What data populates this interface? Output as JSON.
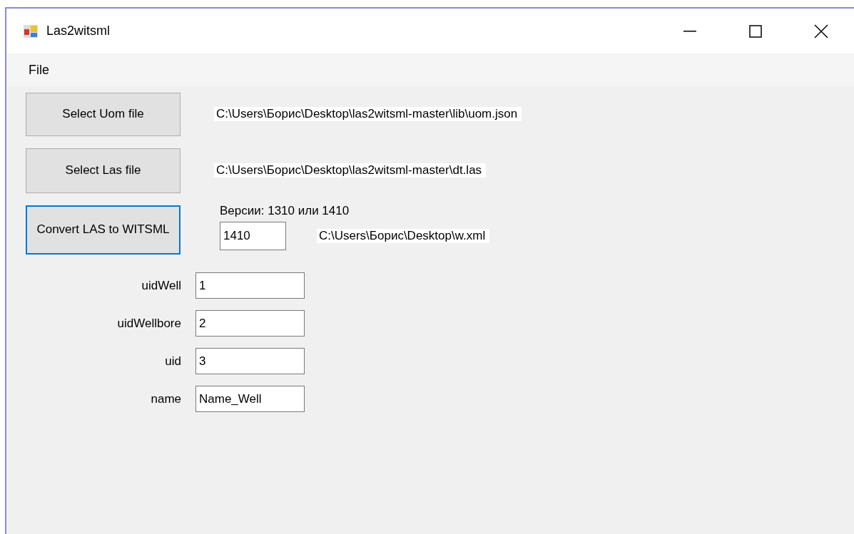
{
  "window": {
    "title": "Las2witsml"
  },
  "menu": [
    {
      "label": "File"
    }
  ],
  "file_rows": [
    {
      "button": "Select Uom file",
      "focused": false,
      "path": "C:\\Users\\Борис\\Desktop\\las2witsml-master\\lib\\uom.json"
    },
    {
      "button": "Select Las file",
      "focused": false,
      "path": "C:\\Users\\Борис\\Desktop\\las2witsml-master\\dt.las"
    }
  ],
  "convert": {
    "button": "Convert LAS to WITSML",
    "focused": true,
    "versions_label": "Версии: 1310 или 1410",
    "version": "1410",
    "output_path": "C:\\Users\\Борис\\Desktop\\w.xml"
  },
  "fields": [
    {
      "label": "uidWell",
      "value": "1"
    },
    {
      "label": "uidWellbore",
      "value": "2"
    },
    {
      "label": "uid",
      "value": "3"
    },
    {
      "label": "name",
      "value": "Name_Well"
    }
  ]
}
